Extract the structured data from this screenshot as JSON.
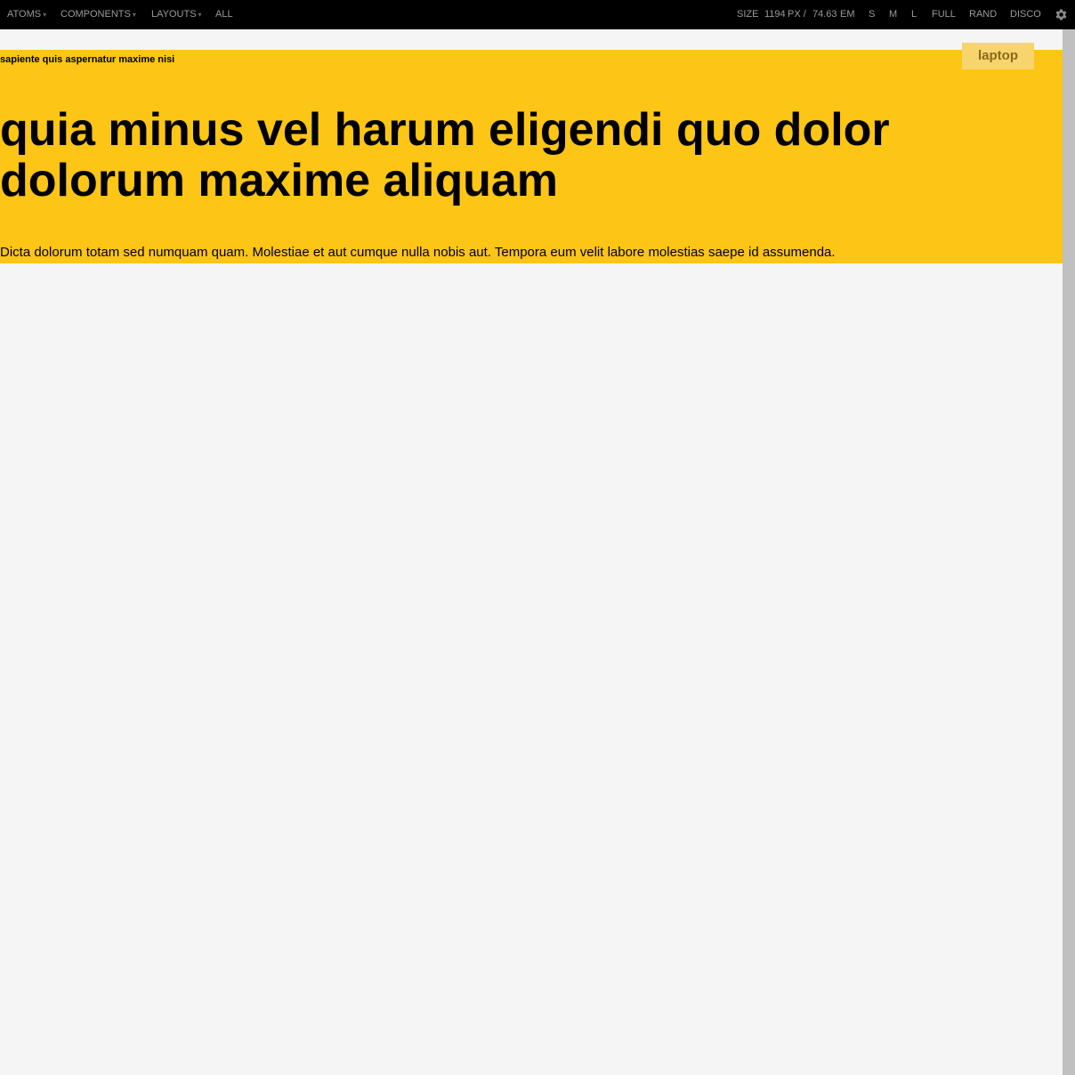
{
  "toolbar": {
    "nav": {
      "atoms": "ATOMS",
      "components": "COMPONENTS",
      "layouts": "LAYOUTS",
      "all": "ALL"
    },
    "caret": "▾",
    "size_label": "SIZE",
    "size_px": "1194",
    "px_unit": "PX /",
    "size_em": "74.63",
    "em_unit": "EM",
    "sizes": {
      "s": "S",
      "m": "M",
      "l": "L",
      "full": "FULL",
      "rand": "RAND",
      "disco": "DISCO"
    },
    "settings_icon": "gear-icon"
  },
  "hero": {
    "eyebrow": "sapiente quis aspernatur maxime nisi",
    "headline": "quia minus vel harum eligendi quo dolor dolorum maxime aliquam",
    "lede": "Dicta dolorum totam sed numquam quam. Molestiae et aut cumque nulla nobis aut. Tempora eum velit labore molestias saepe id assumenda.",
    "breakpoint_badge": "laptop"
  },
  "colors": {
    "toolbar_bg": "#000000",
    "toolbar_text": "#9a9a9a",
    "hero_bg": "#fdc515",
    "badge_bg": "#f7d46e",
    "badge_text": "#8a6a15",
    "page_bg": "#f5f5f5",
    "scrollbar": "#c0c0c0"
  }
}
